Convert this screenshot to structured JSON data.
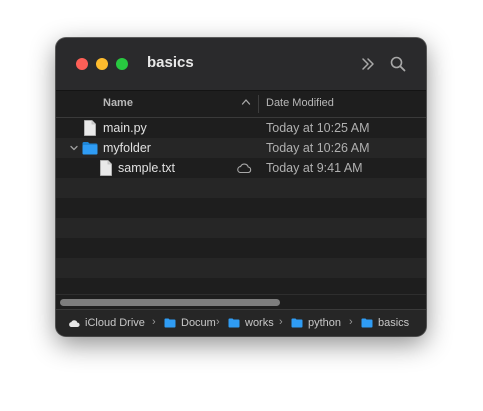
{
  "window": {
    "title": "basics"
  },
  "columns": {
    "name": "Name",
    "date_modified": "Date Modified"
  },
  "files": [
    {
      "name": "main.py",
      "date": "Today at 10:25 AM",
      "type": "file"
    },
    {
      "name": "myfolder",
      "date": "Today at 10:26 AM",
      "type": "folder",
      "expanded": true
    },
    {
      "name": "sample.txt",
      "date": "Today at 9:41 AM",
      "type": "file",
      "cloud": true
    }
  ],
  "pathbar": {
    "items": [
      {
        "label": "iCloud Drive",
        "icon": "cloud-icon"
      },
      {
        "label": "Docum",
        "icon": "folder-icon"
      },
      {
        "label": "works",
        "icon": "folder-icon"
      },
      {
        "label": "python",
        "icon": "folder-icon"
      },
      {
        "label": "basics",
        "icon": "folder-icon"
      }
    ],
    "separator": "›"
  },
  "colors": {
    "folder": "#2f9cf4",
    "close": "#fe5f57",
    "minimize": "#febc2e",
    "zoom": "#28c840"
  }
}
